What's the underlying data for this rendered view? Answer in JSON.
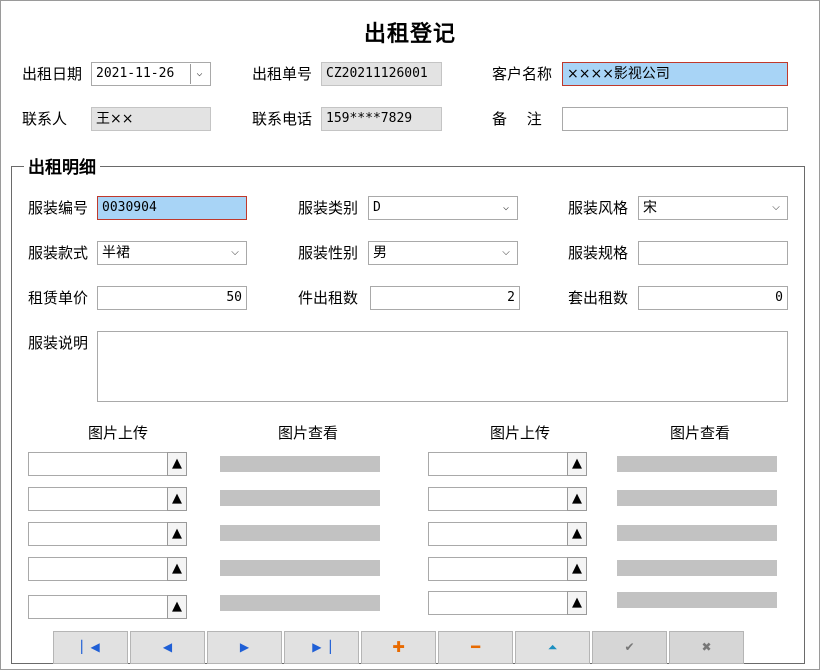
{
  "title": "出租登记",
  "header": {
    "rent_date_label": "出租日期",
    "rent_date_value": "2021-11-26",
    "rent_no_label": "出租单号",
    "rent_no_value": "CZ20211126001",
    "customer_label": "客户名称",
    "customer_value": "××××影视公司",
    "contact_label": "联系人",
    "contact_value": "王××",
    "phone_label": "联系电话",
    "phone_value": "159****7829",
    "remark_label": "备　 注",
    "remark_value": ""
  },
  "detail": {
    "group_title": "出租明细",
    "costume_no_label": "服装编号",
    "costume_no_value": "0030904",
    "category_label": "服装类别",
    "category_value": "D",
    "style_label": "服装风格",
    "style_value": "宋",
    "model_label": "服装款式",
    "model_value": "半裙",
    "gender_label": "服装性别",
    "gender_value": "男",
    "spec_label": "服装规格",
    "spec_value": "",
    "unit_price_label": "租赁单价",
    "unit_price_value": "50",
    "piece_count_label": "件出租数",
    "piece_count_value": "2",
    "set_count_label": "套出租数",
    "set_count_value": "0",
    "description_label": "服装说明",
    "description_value": ""
  },
  "images": {
    "upload_header": "图片上传",
    "view_header": "图片查看",
    "upload_glyph": "▲"
  },
  "icons": {
    "dropdown": "⌵",
    "first": "▏◀",
    "prev": "◀",
    "next": "▶",
    "last": "▶▕",
    "add": "✚",
    "delete": "━",
    "up": "⏶",
    "confirm": "✔",
    "cancel": "✖"
  },
  "colors": {
    "selected_field_bg": "#a8d4f6",
    "selected_field_border": "#c0392b",
    "readonly_bg": "#e3e3e3",
    "nav_blue": "#1f5fd6",
    "nav_orange": "#e86a00"
  }
}
